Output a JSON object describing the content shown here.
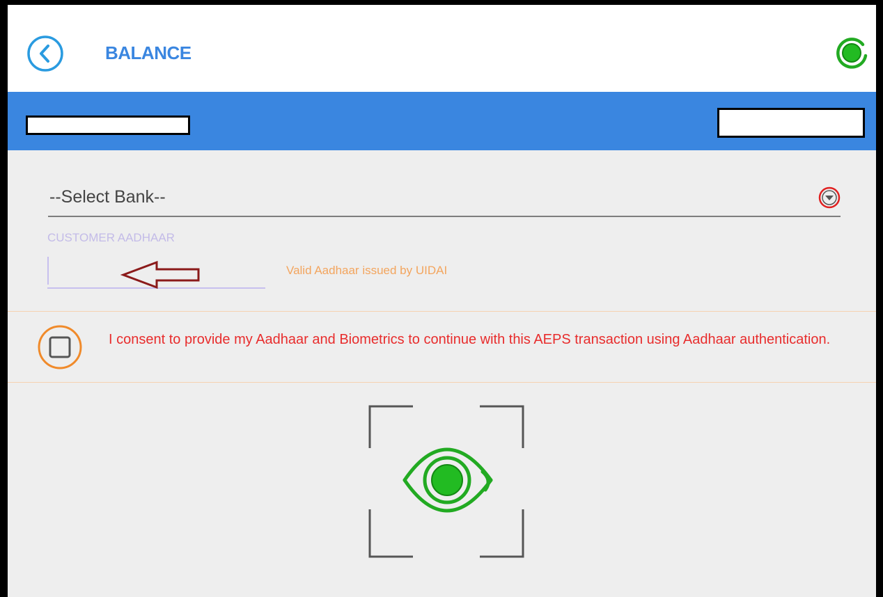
{
  "header": {
    "title": "BALANCE",
    "back_icon": "back-arrow-icon",
    "status_icon": "device-connected-icon"
  },
  "form": {
    "bank_select": {
      "selected": "--Select Bank--"
    },
    "aadhaar": {
      "label": "CUSTOMER AADHAAR",
      "value": "",
      "hint": "Valid Aadhaar issued by UIDAI"
    },
    "consent": {
      "checked": false,
      "text": "I consent to provide my Aadhaar and Biometrics to continue with this AEPS transaction using Aadhaar authentication."
    }
  },
  "scanner": {
    "icon": "iris-scan-icon"
  },
  "colors": {
    "brand_blue": "#3a86e0",
    "consent_red": "#e82c2c",
    "hint_orange": "#f3a55e",
    "scan_green": "#22aa22"
  }
}
